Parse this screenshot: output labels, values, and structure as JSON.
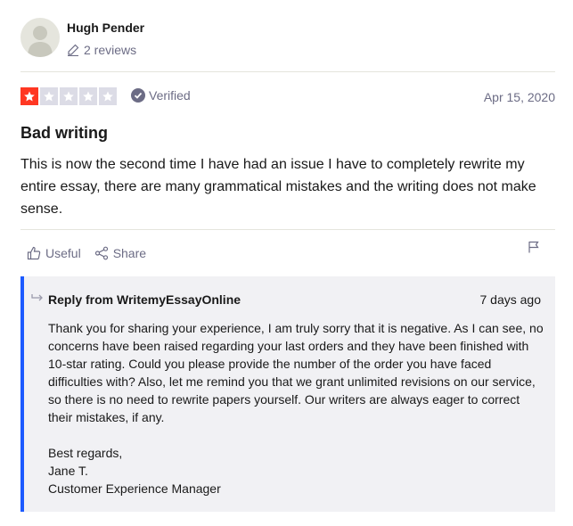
{
  "reviewer": {
    "name": "Hugh Pender",
    "review_count": "2 reviews"
  },
  "rating": {
    "stars": 1,
    "max_stars": 5,
    "verified_label": "Verified",
    "date": "Apr 15, 2020"
  },
  "review": {
    "title": "Bad writing",
    "body": "This is now the second time I have had an issue I have to completely rewrite my entire essay, there are many grammatical mistakes and the writing does not make sense."
  },
  "actions": {
    "useful_label": "Useful",
    "share_label": "Share"
  },
  "reply": {
    "from": "Reply from WritemyEssayOnline",
    "date": "7 days ago",
    "body": "Thank you for sharing your experience, I am truly sorry that it is negative. As I can see, no concerns have been raised regarding your last orders and they have been finished with 10-star rating. Could you please provide the number of the order you have faced difficulties with? Also, let me remind you that we grant unlimited revisions on our service, so there is no need to rewrite papers yourself. Our writers are always eager to correct their mistakes, if any.",
    "signoff": [
      "Best regards,",
      "Jane T.",
      "Customer Experience Manager"
    ]
  },
  "colors": {
    "star_filled": "#ff3722",
    "star_empty": "#dcdce6",
    "reply_accent": "#1c5aff",
    "reply_background": "#f1f1f4",
    "muted_text": "#6c6c85"
  },
  "icons": {
    "avatar": "user-silhouette-icon",
    "review_count": "pencil-icon",
    "verified": "check-circle-icon",
    "useful": "thumbs-up-icon",
    "share": "share-icon",
    "report": "flag-icon",
    "reply": "reply-arrow-icon"
  }
}
